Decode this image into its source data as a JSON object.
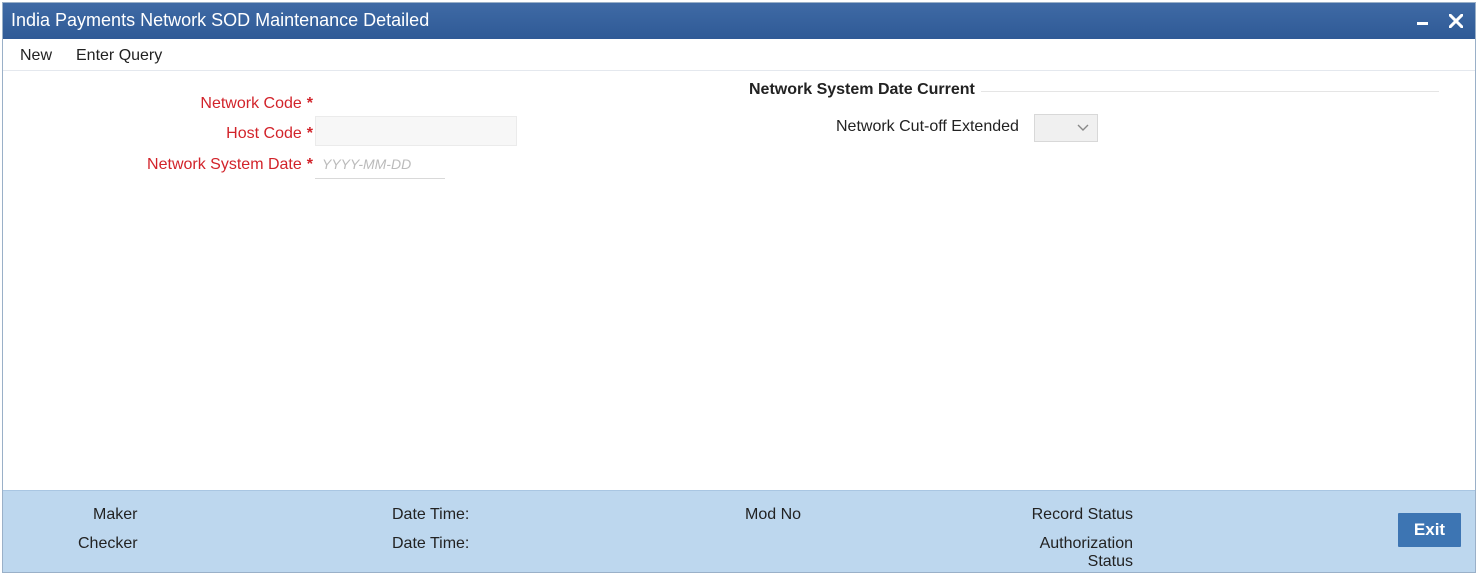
{
  "window": {
    "title": "India Payments Network SOD Maintenance Detailed",
    "minimize_icon": "minimize-icon",
    "close_icon": "close-icon",
    "title_bar_color": "#2f5a96"
  },
  "menu": {
    "new_label": "New",
    "enter_query_label": "Enter Query"
  },
  "form": {
    "network_code_label": "Network Code",
    "host_code_label": "Host Code",
    "network_system_date_label": "Network System Date",
    "required_mark": "*",
    "network_system_date_placeholder": "YYYY-MM-DD",
    "network_code_value": "",
    "host_code_value": "",
    "network_system_date_value": "",
    "required_color": "#d2232a"
  },
  "section": {
    "title": "Network System Date Current",
    "cutoff_label": "Network Cut-off Extended",
    "cutoff_selected": ""
  },
  "footer": {
    "maker_label": "Maker",
    "checker_label": "Checker",
    "date_time_label_1": "Date Time:",
    "date_time_label_2": "Date Time:",
    "mod_no_label": "Mod No",
    "record_status_label": "Record Status",
    "authorization_label": "Authorization",
    "status_label": "Status",
    "exit_label": "Exit",
    "background_color": "#bdd7ee",
    "exit_color": "#3d75b3"
  }
}
